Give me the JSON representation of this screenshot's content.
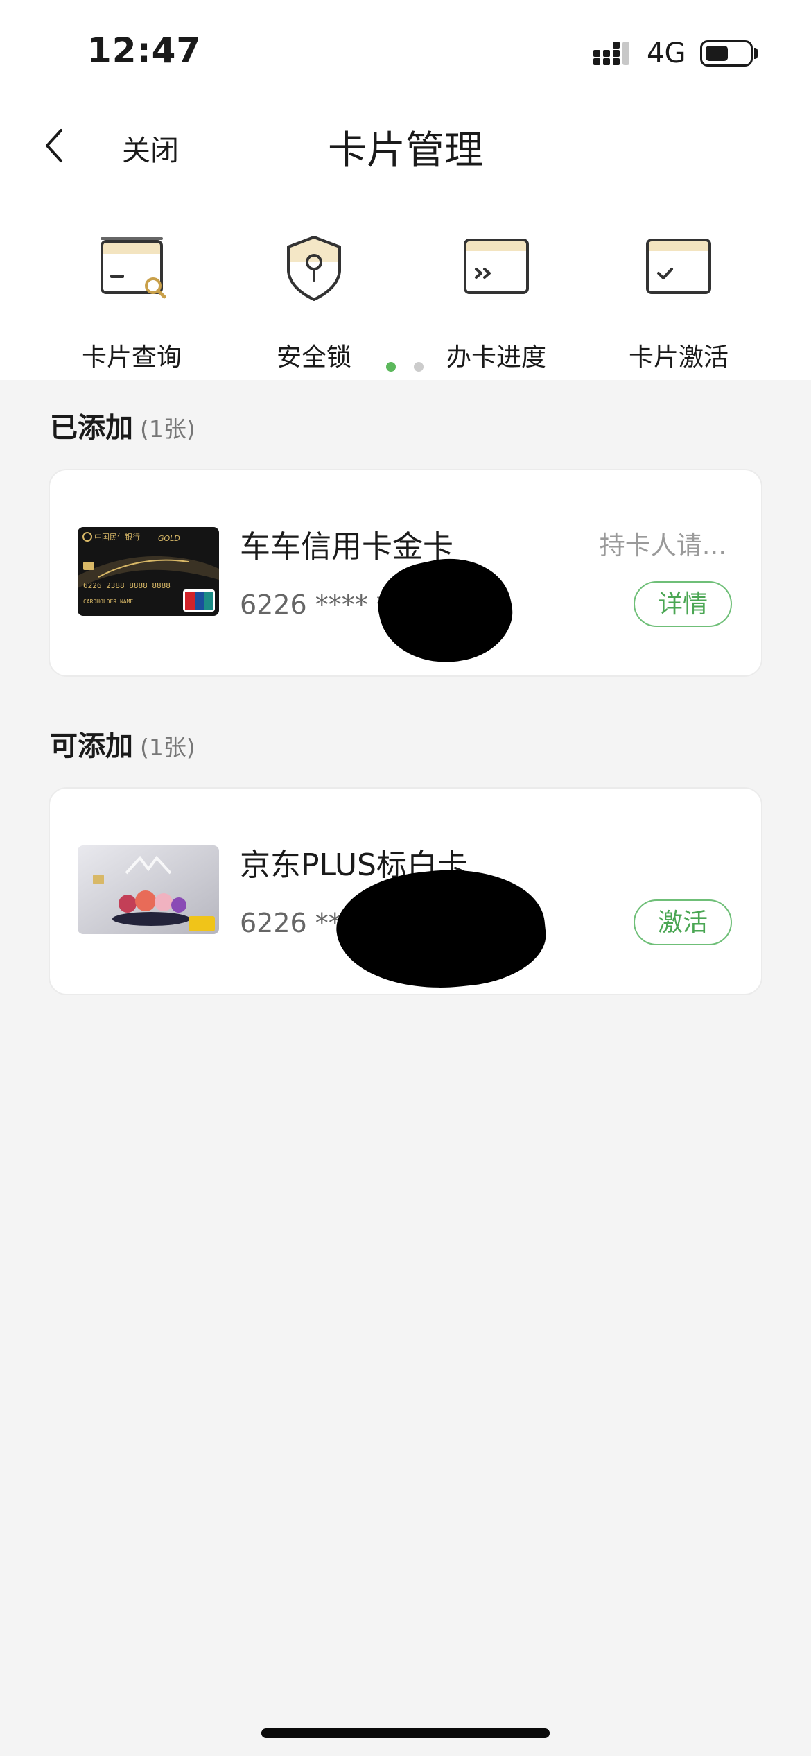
{
  "status_bar": {
    "time": "12:47",
    "network": "4G",
    "battery_level": 0.5
  },
  "nav": {
    "close_label": "关闭",
    "title": "卡片管理"
  },
  "quick_actions": [
    {
      "label": "卡片查询",
      "icon": "card-search-icon"
    },
    {
      "label": "安全锁",
      "icon": "shield-lock-icon"
    },
    {
      "label": "办卡进度",
      "icon": "card-progress-icon"
    },
    {
      "label": "卡片激活",
      "icon": "card-activate-icon"
    }
  ],
  "pager": {
    "pages": 2,
    "active": 0
  },
  "added": {
    "title": "已添加",
    "count": "(1张)",
    "card": {
      "name": "车车信用卡金卡",
      "number": "6226 **** ****",
      "holder": "持卡人请...",
      "action": "详情",
      "image_text": {
        "bank": "中国民生银行",
        "tier": "GOLD",
        "pan": "6226 2388 8888 8888",
        "holder": "CARDHOLDER NAME"
      }
    }
  },
  "available": {
    "title": "可添加",
    "count": "(1张)",
    "card": {
      "name": "京东PLUS标白卡",
      "number": "6226 **** ****",
      "action": "激活"
    }
  },
  "colors": {
    "accent_green": "#4aa653",
    "background": "#f4f4f4",
    "dot_active": "#5cb85c",
    "dot_inactive": "#cccccc",
    "icon_gold": "#f3e4c0"
  }
}
